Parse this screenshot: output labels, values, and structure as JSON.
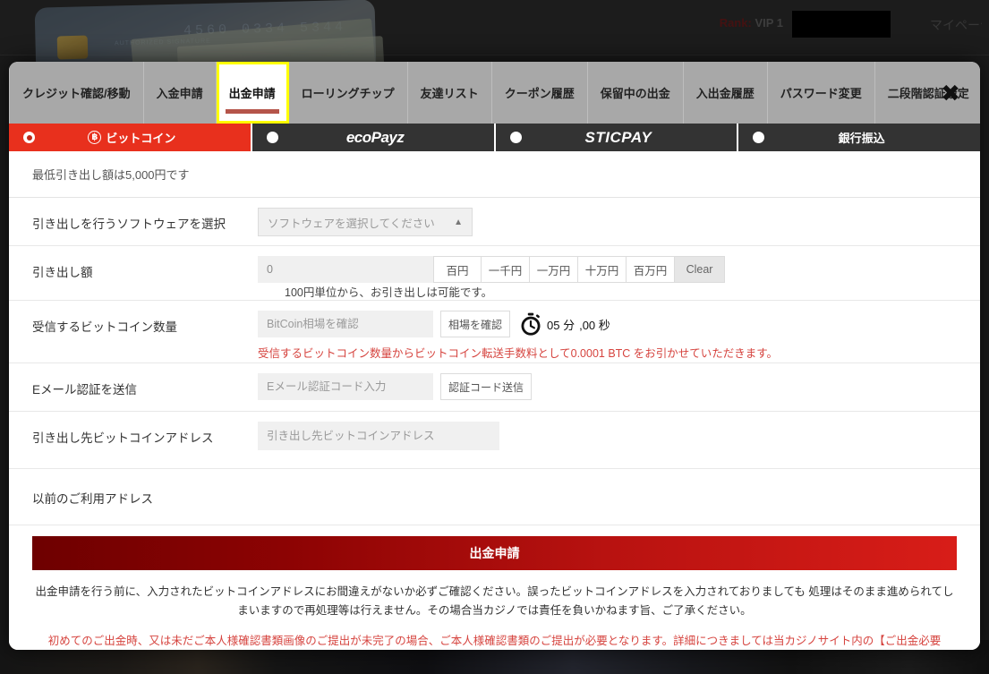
{
  "background": {
    "rank_label": "Rank:",
    "rank_value": "VIP 1",
    "mypage_label": "マイページ",
    "card_number": "4560  0334  5344",
    "card_signature": "AUTHORIZED SIGNATURE"
  },
  "modal": {
    "close_icon": "close-icon",
    "tabs": [
      {
        "label": "クレジット確認/移動",
        "active": false
      },
      {
        "label": "入金申請",
        "active": false
      },
      {
        "label": "出金申請",
        "active": true
      },
      {
        "label": "ローリングチップ",
        "active": false
      },
      {
        "label": "友達リスト",
        "active": false
      },
      {
        "label": "クーポン履歴",
        "active": false
      },
      {
        "label": "保留中の出金",
        "active": false
      },
      {
        "label": "入出金履歴",
        "active": false
      },
      {
        "label": "パスワード変更",
        "active": false
      },
      {
        "label": "二段階認証設定",
        "active": false
      }
    ],
    "methods": [
      {
        "label": "ビットコイン",
        "selected": true,
        "style": "bitcoin"
      },
      {
        "label": "ecoPayz",
        "selected": false,
        "style": "ecopayz"
      },
      {
        "label": "STICPAY",
        "selected": false,
        "style": "sticpay"
      },
      {
        "label": "銀行振込",
        "selected": false,
        "style": "bank"
      }
    ],
    "min_note": "最低引き出し額は5,000円です",
    "form": {
      "software": {
        "label": "引き出しを行うソフトウェアを選択",
        "value": "ソフトウェアを選択してください",
        "caret": "▲"
      },
      "amount": {
        "label": "引き出し額",
        "value": "0",
        "quick_buttons": [
          "百円",
          "一千円",
          "一万円",
          "十万円",
          "百万円"
        ],
        "clear_label": "Clear",
        "side_note": "100円単位から、お引き出しは可能です。"
      },
      "btc": {
        "label": "受信するビットコイン数量",
        "placeholder": "BitCoin相場を確認",
        "check_button": "相場を確認",
        "timer_minutes": "05 分",
        "timer_seconds": ",00 秒",
        "warning": "受信するビットコイン数量からビットコイン転送手数料として0.0001 BTC をお引かせていただきます。"
      },
      "email": {
        "label": "Eメール認証を送信",
        "placeholder": "Eメール認証コード入力",
        "send_button": "認証コード送信"
      },
      "address": {
        "label": "引き出し先ビットコインアドレス",
        "placeholder": "引き出し先ビットコインアドレス"
      },
      "previous_addresses_label": "以前のご利用アドレス"
    },
    "submit_label": "出金申請",
    "disclaimer": "出金申請を行う前に、入力されたビットコインアドレスにお間違えがないか必ずご確認ください。誤ったビットコインアドレスを入力されておりましても 処理はそのまま進められてしまいますので再処理等は行えません。その場合当カジノでは責任を負いかねます旨、ご了承ください。",
    "disclaimer_red": "初めてのご出金時、又は未だご本人様確認書類画像のご提出が未完了の場合、ご本人様確認書類のご提出が必要となります。詳細につきましては当カジノサイト内の【ご出金必要書類】ページをご確認ください。"
  },
  "colors": {
    "accent_red": "#e8301d",
    "submit_dark": "#6e0000",
    "submit_bright": "#d81d18",
    "highlight_yellow": "#ffff00",
    "tabbar_gray": "#a8a8a8"
  }
}
